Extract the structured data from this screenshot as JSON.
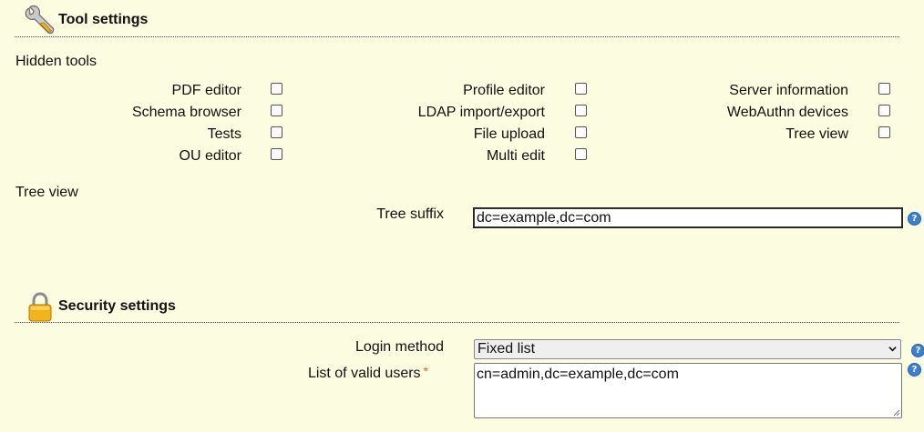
{
  "tool_settings": {
    "title": "Tool settings",
    "hidden_tools": {
      "label": "Hidden tools",
      "columns": [
        [
          {
            "label": "PDF editor",
            "checked": false
          },
          {
            "label": "Schema browser",
            "checked": false
          },
          {
            "label": "Tests",
            "checked": false
          },
          {
            "label": "OU editor",
            "checked": false
          }
        ],
        [
          {
            "label": "Profile editor",
            "checked": false
          },
          {
            "label": "LDAP import/export",
            "checked": false
          },
          {
            "label": "File upload",
            "checked": false
          },
          {
            "label": "Multi edit",
            "checked": false
          }
        ],
        [
          {
            "label": "Server information",
            "checked": false
          },
          {
            "label": "WebAuthn devices",
            "checked": false
          },
          {
            "label": "Tree view",
            "checked": false
          }
        ]
      ]
    },
    "tree_view": {
      "label": "Tree view",
      "tree_suffix_label": "Tree suffix",
      "tree_suffix_value": "dc=example,dc=com"
    }
  },
  "security_settings": {
    "title": "Security settings",
    "login_method_label": "Login method",
    "login_method_value": "Fixed list",
    "valid_users_label": "List of valid users",
    "valid_users_required_mark": "*",
    "valid_users_value": "cn=admin,dc=example,dc=com"
  },
  "icons": {
    "tool_header": "wrench-icon",
    "security_header": "lock-icon",
    "help": "help-icon",
    "help_glyph": "?"
  },
  "colors": {
    "background": "#fcfce1",
    "help_blue": "#3b7fd0",
    "required_star": "#e05a2a"
  }
}
